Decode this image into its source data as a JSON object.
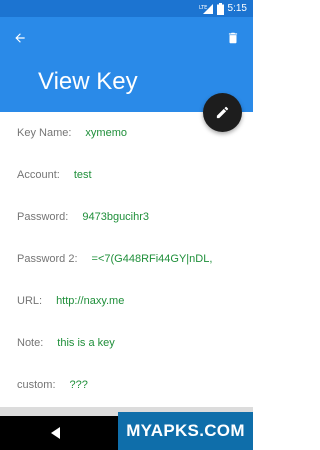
{
  "status_bar": {
    "network": "LTE",
    "time": "5:15"
  },
  "app_bar": {
    "title": "View Key"
  },
  "fields": [
    {
      "label": "Key Name:",
      "value": "xymemo"
    },
    {
      "label": "Account:",
      "value": "test"
    },
    {
      "label": "Password:",
      "value": "9473bgucihr3"
    },
    {
      "label": "Password 2:",
      "value": "=<7(G448RFi44GY|nDL,"
    },
    {
      "label": "URL:",
      "value": "http://naxy.me"
    },
    {
      "label": "Note:",
      "value": "this is a key"
    },
    {
      "label": "custom:",
      "value": "???"
    }
  ],
  "watermark": {
    "text": "MYAPKS.COM"
  },
  "colors": {
    "primary": "#2a8ae8",
    "primary_dark": "#1c74d1",
    "value_text": "#1f8f3a",
    "label_text": "#757575",
    "fab": "#1d1d1d"
  },
  "icons": {
    "back": "arrow-left-icon",
    "delete": "trash-icon",
    "edit": "pencil-icon"
  }
}
